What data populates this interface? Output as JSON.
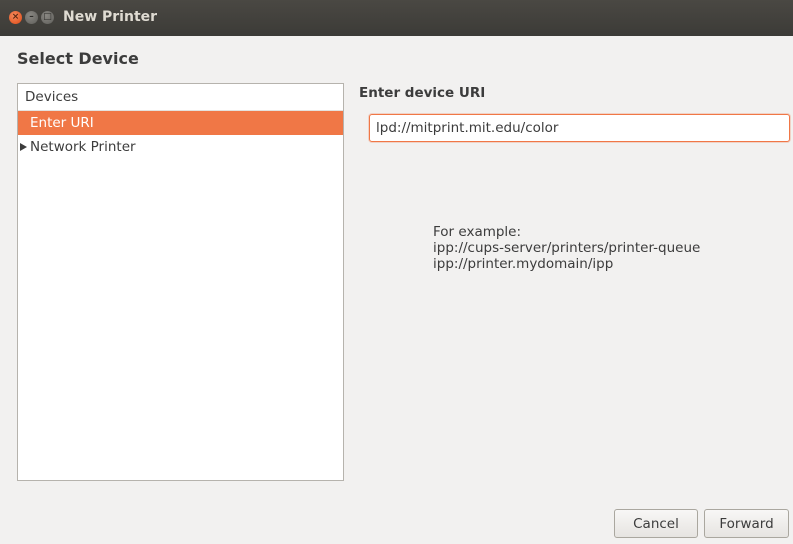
{
  "window": {
    "title": "New Printer",
    "close_glyph": "×",
    "min_glyph": "–",
    "max_glyph": "□"
  },
  "page": {
    "title": "Select Device"
  },
  "devices": {
    "header": "Devices",
    "items": [
      {
        "label": "Enter URI",
        "selected": true
      },
      {
        "label": "Network Printer",
        "expandable": true
      }
    ]
  },
  "uri": {
    "heading": "Enter device URI",
    "value": "lpd://mitprint.mit.edu/color"
  },
  "example": {
    "label": "For example:",
    "line1": "ipp://cups-server/printers/printer-queue",
    "line2": "ipp://printer.mydomain/ipp"
  },
  "buttons": {
    "cancel": "Cancel",
    "forward": "Forward"
  },
  "colors": {
    "accent": "#f07746",
    "titlebar": "#3c3b37",
    "background": "#f2f1f0"
  }
}
